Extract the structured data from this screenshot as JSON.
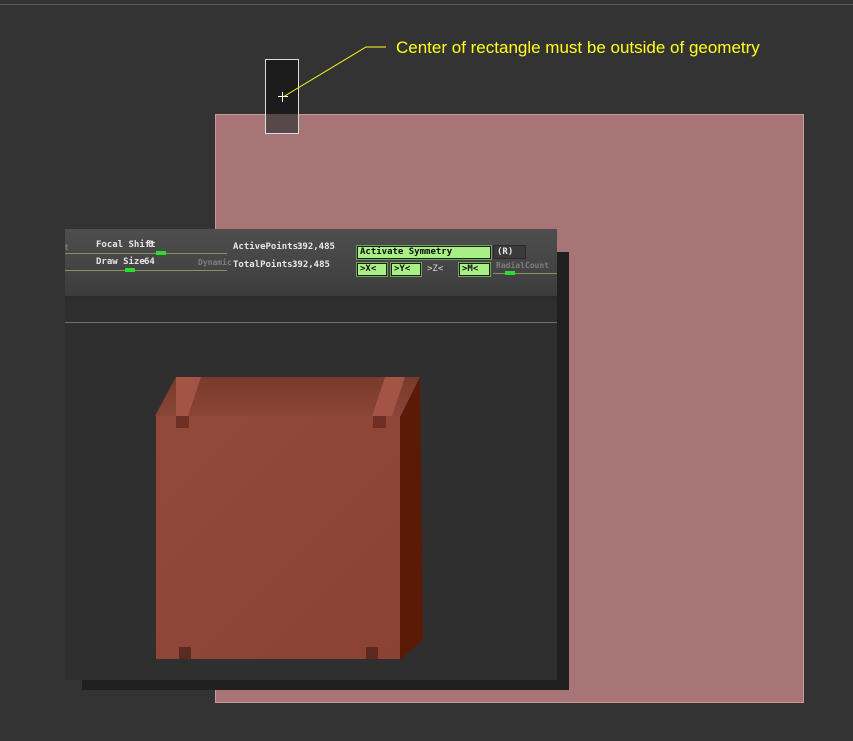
{
  "annotation": {
    "text": "Center of rectangle must be outside of geometry",
    "color": "#ffff1e"
  },
  "toolbar": {
    "edge_label": "t",
    "focal_shift": {
      "label": "Focal Shift",
      "value": "0"
    },
    "draw_size": {
      "label": "Draw Size",
      "value": "64"
    },
    "dynamic_label": "Dynamic",
    "active_points": {
      "label": "ActivePoints:",
      "value": "392,485"
    },
    "total_points": {
      "label": "TotalPoints:",
      "value": "392,485"
    },
    "activate_symmetry_label": "Activate Symmetry",
    "r_label": "(R)",
    "axis_x_label": ">X<",
    "axis_y_label": ">Y<",
    "axis_z_label": ">Z<",
    "axis_m_label": ">M<",
    "radial_count_label": "RadialCount"
  },
  "colors": {
    "background": "#333333",
    "selection_rect": "#a87576",
    "accent_green": "#a8ef86",
    "slider_knob": "#2edc2e",
    "model_front": "#8f4536",
    "model_side": "#5a1a05"
  },
  "icons": [
    "crosshair-icon",
    "slider-knob-icon"
  ]
}
